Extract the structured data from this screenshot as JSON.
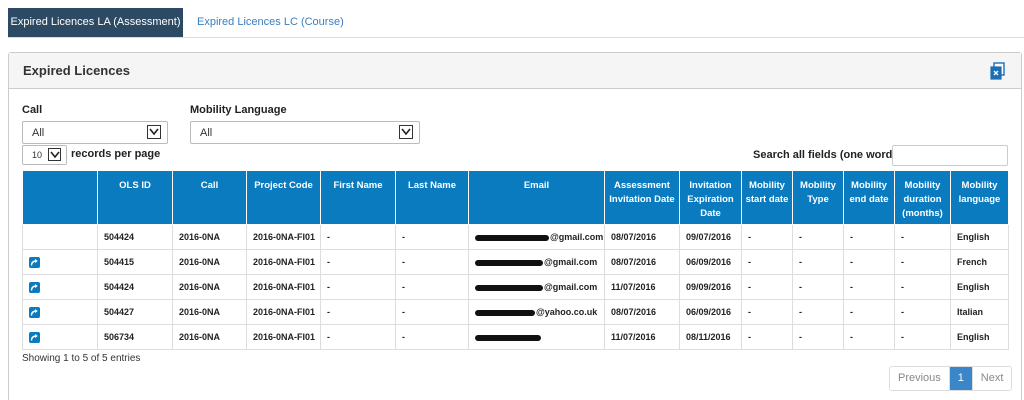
{
  "tabs": [
    {
      "label": "Expired Licences LA (Assessment)",
      "active": true
    },
    {
      "label": "Expired Licences LC (Course)",
      "active": false
    }
  ],
  "panel": {
    "title": "Expired Licences",
    "export_icon": "export-icon"
  },
  "filters": {
    "call": {
      "label": "Call",
      "value": "All"
    },
    "language": {
      "label": "Mobility Language",
      "value": "All"
    },
    "page_size": {
      "value": "10",
      "suffix": "records per page"
    },
    "search": {
      "label": "Search all fields (one word)",
      "value": ""
    }
  },
  "table": {
    "columns": [
      "",
      "OLS ID",
      "Call",
      "Project Code",
      "First Name",
      "Last Name",
      "Email",
      "Assessment Invitation Date",
      "Invitation Expiration Date",
      "Mobility start date",
      "Mobility Type",
      "Mobility end date",
      "Mobility duration (months)",
      "Mobility language"
    ],
    "rows": [
      {
        "action": false,
        "ols_id": "504424",
        "call": "2016-0NA",
        "project": "2016-0NA-FI01",
        "first": "-",
        "last": "-",
        "email": "@gmail.com",
        "assess": "08/07/2016",
        "expire": "09/07/2016",
        "mstart": "-",
        "mtype": "-",
        "mend": "-",
        "mdur": "-",
        "mlang": "English"
      },
      {
        "action": true,
        "ols_id": "504415",
        "call": "2016-0NA",
        "project": "2016-0NA-FI01",
        "first": "-",
        "last": "-",
        "email": "@gmail.com",
        "assess": "08/07/2016",
        "expire": "06/09/2016",
        "mstart": "-",
        "mtype": "-",
        "mend": "-",
        "mdur": "-",
        "mlang": "French"
      },
      {
        "action": true,
        "ols_id": "504424",
        "call": "2016-0NA",
        "project": "2016-0NA-FI01",
        "first": "-",
        "last": "-",
        "email": "@gmail.com",
        "assess": "11/07/2016",
        "expire": "09/09/2016",
        "mstart": "-",
        "mtype": "-",
        "mend": "-",
        "mdur": "-",
        "mlang": "English"
      },
      {
        "action": true,
        "ols_id": "504427",
        "call": "2016-0NA",
        "project": "2016-0NA-FI01",
        "first": "-",
        "last": "-",
        "email": "@yahoo.co.uk",
        "assess": "08/07/2016",
        "expire": "06/09/2016",
        "mstart": "-",
        "mtype": "-",
        "mend": "-",
        "mdur": "-",
        "mlang": "Italian"
      },
      {
        "action": true,
        "ols_id": "506734",
        "call": "2016-0NA",
        "project": "2016-0NA-FI01",
        "first": "-",
        "last": "-",
        "email": "",
        "assess": "11/07/2016",
        "expire": "08/11/2016",
        "mstart": "-",
        "mtype": "-",
        "mend": "-",
        "mdur": "-",
        "mlang": "English"
      }
    ]
  },
  "footer": {
    "info": "Showing 1 to 5 of 5 entries",
    "prev": "Previous",
    "page": "1",
    "next": "Next"
  },
  "colors": {
    "header_blue": "#0b7bbf",
    "tab_active": "#2c4a63",
    "link": "#3a7fbf"
  }
}
